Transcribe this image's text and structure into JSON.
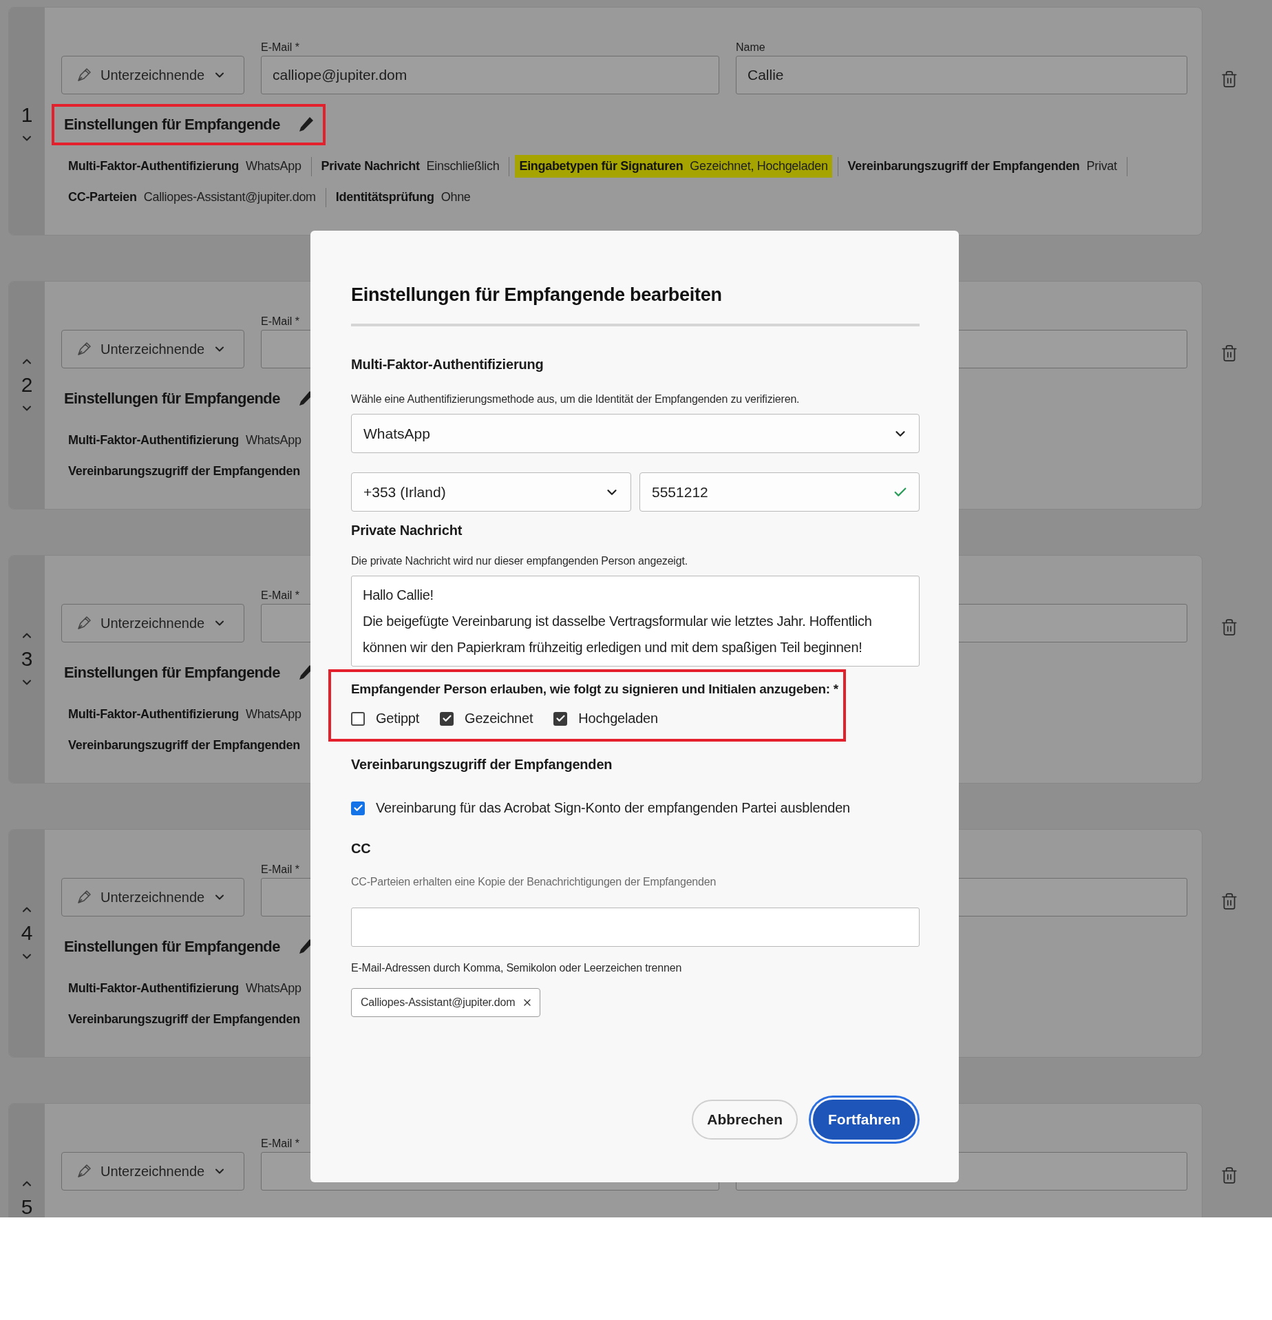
{
  "recipients": [
    {
      "number": "1",
      "can_move_up": false,
      "role": "Unterzeichnende",
      "email_label": "E-Mail *",
      "email": "calliope@jupiter.dom",
      "name_label": "Name",
      "name": "Callie",
      "settings_title": "Einstellungen für Empfangende",
      "title_annotated": true,
      "rows": [
        [
          {
            "label": "Multi-Faktor-Authentifizierung",
            "value": "WhatsApp",
            "highlighted": false
          },
          {
            "label": "Private Nachricht",
            "value": "Einschließlich",
            "highlighted": false
          },
          {
            "label": "Eingabetypen für Signaturen",
            "value": "Gezeichnet, Hochgeladen",
            "highlighted": true
          },
          {
            "label": "Vereinbarungszugriff der Empfangenden",
            "value": "Privat",
            "highlighted": false
          }
        ],
        [
          {
            "label": "CC-Parteien",
            "value": "Calliopes-Assistant@jupiter.dom",
            "highlighted": false
          },
          {
            "label": "Identitätsprüfung",
            "value": "Ohne",
            "highlighted": false
          }
        ]
      ]
    },
    {
      "number": "2",
      "can_move_up": true,
      "role": "Unterzeichnende",
      "email_label": "E-Mail *",
      "settings_title": "Einstellungen für Empfangende",
      "title_annotated": false,
      "rows": [
        [
          {
            "label": "Multi-Faktor-Authentifizierung",
            "value": "WhatsApp",
            "highlighted": false
          }
        ],
        [
          {
            "label": "Vereinbarungszugriff der Empfangenden",
            "highlighted": false
          }
        ]
      ]
    },
    {
      "number": "3",
      "can_move_up": true,
      "role": "Unterzeichnende",
      "email_label": "E-Mail *",
      "settings_title": "Einstellungen für Empfangende",
      "title_annotated": false,
      "rows": [
        [
          {
            "label": "Multi-Faktor-Authentifizierung",
            "value": "WhatsApp",
            "highlighted": false
          }
        ],
        [
          {
            "label": "Vereinbarungszugriff der Empfangenden",
            "highlighted": false
          }
        ]
      ]
    },
    {
      "number": "4",
      "can_move_up": true,
      "role": "Unterzeichnende",
      "email_label": "E-Mail *",
      "settings_title": "Einstellungen für Empfangende",
      "title_annotated": false,
      "rows": [
        [
          {
            "label": "Multi-Faktor-Authentifizierung",
            "value": "WhatsApp",
            "highlighted": false
          }
        ],
        [
          {
            "label": "Vereinbarungszugriff der Empfangenden",
            "highlighted": false
          }
        ]
      ]
    },
    {
      "number": "5",
      "can_move_up": true,
      "role": "Unterzeichnende",
      "email_label": "E-Mail *"
    }
  ],
  "dialog": {
    "title": "Einstellungen für Empfangende bearbeiten",
    "mfa": {
      "heading": "Multi-Faktor-Authentifizierung",
      "hint": "Wähle eine Authentifizierungsmethode aus, um die Identität der Empfangenden zu verifizieren.",
      "method": "WhatsApp",
      "country": "+353 (Irland)",
      "phone": "5551212",
      "phone_valid": true
    },
    "message": {
      "heading": "Private Nachricht",
      "hint": "Die private Nachricht wird nur dieser empfangenden Person angezeigt.",
      "lines": [
        "Hallo Callie!",
        "Die beigefügte Vereinbarung ist dasselbe Vertragsformular wie letztes Jahr. Hoffentlich können wir den Papierkram frühzeitig erledigen und mit dem spaßigen Teil beginnen!"
      ]
    },
    "signature_types": {
      "label": "Empfangender Person erlauben, wie folgt zu signieren und Initialen anzugeben: *",
      "annotated": true,
      "options": [
        {
          "label": "Getippt",
          "checked": false
        },
        {
          "label": "Gezeichnet",
          "checked": true
        },
        {
          "label": "Hochgeladen",
          "checked": true
        }
      ]
    },
    "access": {
      "heading": "Vereinbarungszugriff der Empfangenden",
      "option": {
        "label": "Vereinbarung für das Acrobat Sign-Konto der empfangenden Partei ausblenden",
        "checked": true
      }
    },
    "cc": {
      "heading": "CC",
      "hint": "CC-Parteien erhalten eine Kopie der Benachrichtigungen der Empfangenden",
      "separator_hint": "E-Mail-Adressen durch Komma, Semikolon oder Leerzeichen trennen",
      "tags": [
        "Calliopes-Assistant@jupiter.dom"
      ]
    },
    "buttons": [
      {
        "label": "Abbrechen",
        "kind": "secondary",
        "focused": false
      },
      {
        "label": "Fortfahren",
        "kind": "primary",
        "focused": true
      }
    ]
  }
}
